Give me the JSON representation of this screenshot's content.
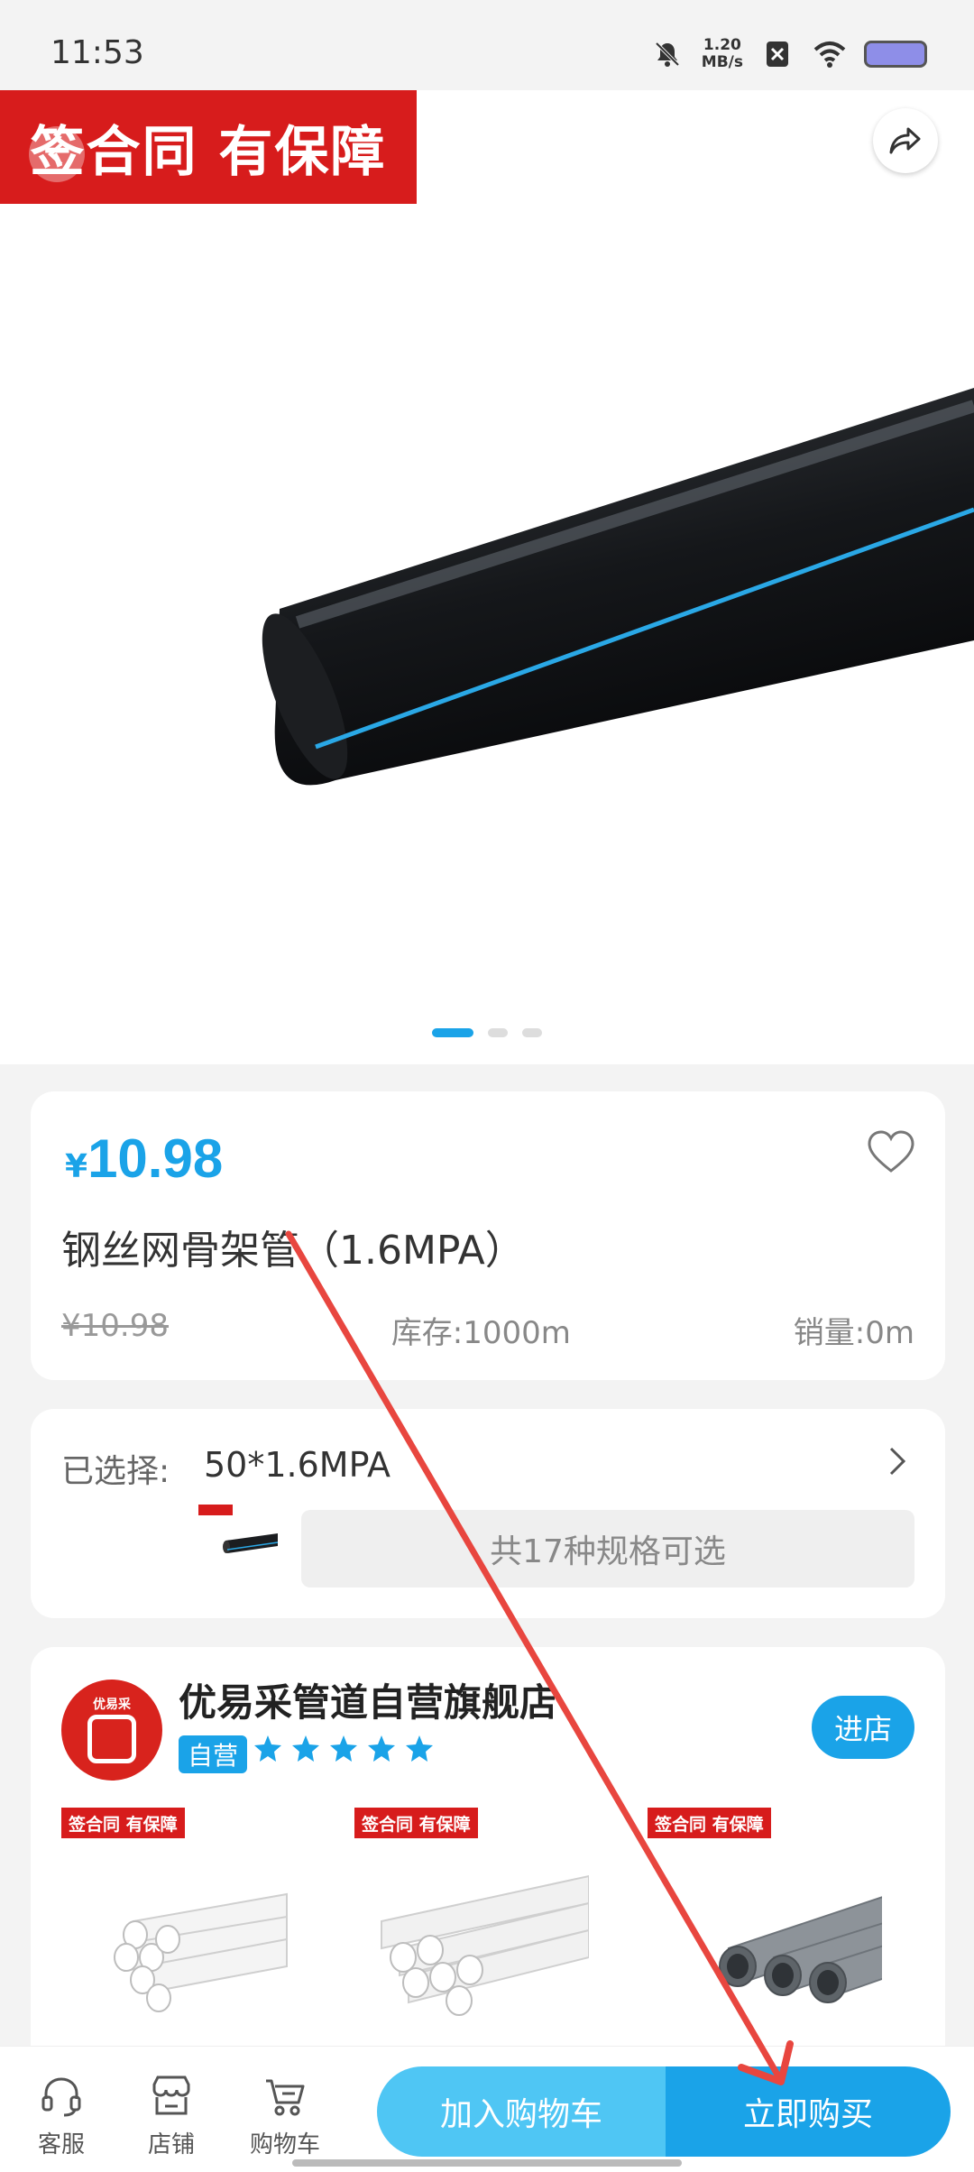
{
  "status_bar": {
    "time": "11:53",
    "net_speed_value": "1.20",
    "net_speed_unit": "MB/s"
  },
  "hero": {
    "promo_text": "签合同 有保障",
    "image_count": 3,
    "active_index": 0
  },
  "product": {
    "currency": "¥",
    "price": "10.98",
    "title": "钢丝网骨架管（1.6MPA）",
    "original_price": "¥10.98",
    "stock": "库存:1000m",
    "sales": "销量:0m"
  },
  "spec": {
    "label": "已选择:",
    "value": "50*1.6MPA",
    "more": "共17种规格可选"
  },
  "store": {
    "name": "优易采管道自营旗舰店",
    "self_badge": "自营",
    "stars": 5,
    "enter_label": "进店",
    "logo_text": "优易采",
    "product_tags": [
      "签合同 有保障",
      "签合同 有保障",
      "签合同 有保障"
    ]
  },
  "bottom_nav": {
    "service": "客服",
    "shop": "店铺",
    "cart": "购物车",
    "add_to_cart": "加入购物车",
    "buy_now": "立即购买"
  },
  "colors": {
    "accent": "#1aa3e8",
    "accent_light": "#4fc6f4",
    "promo_red": "#d71c1c",
    "annotation_red": "#e8463f"
  }
}
